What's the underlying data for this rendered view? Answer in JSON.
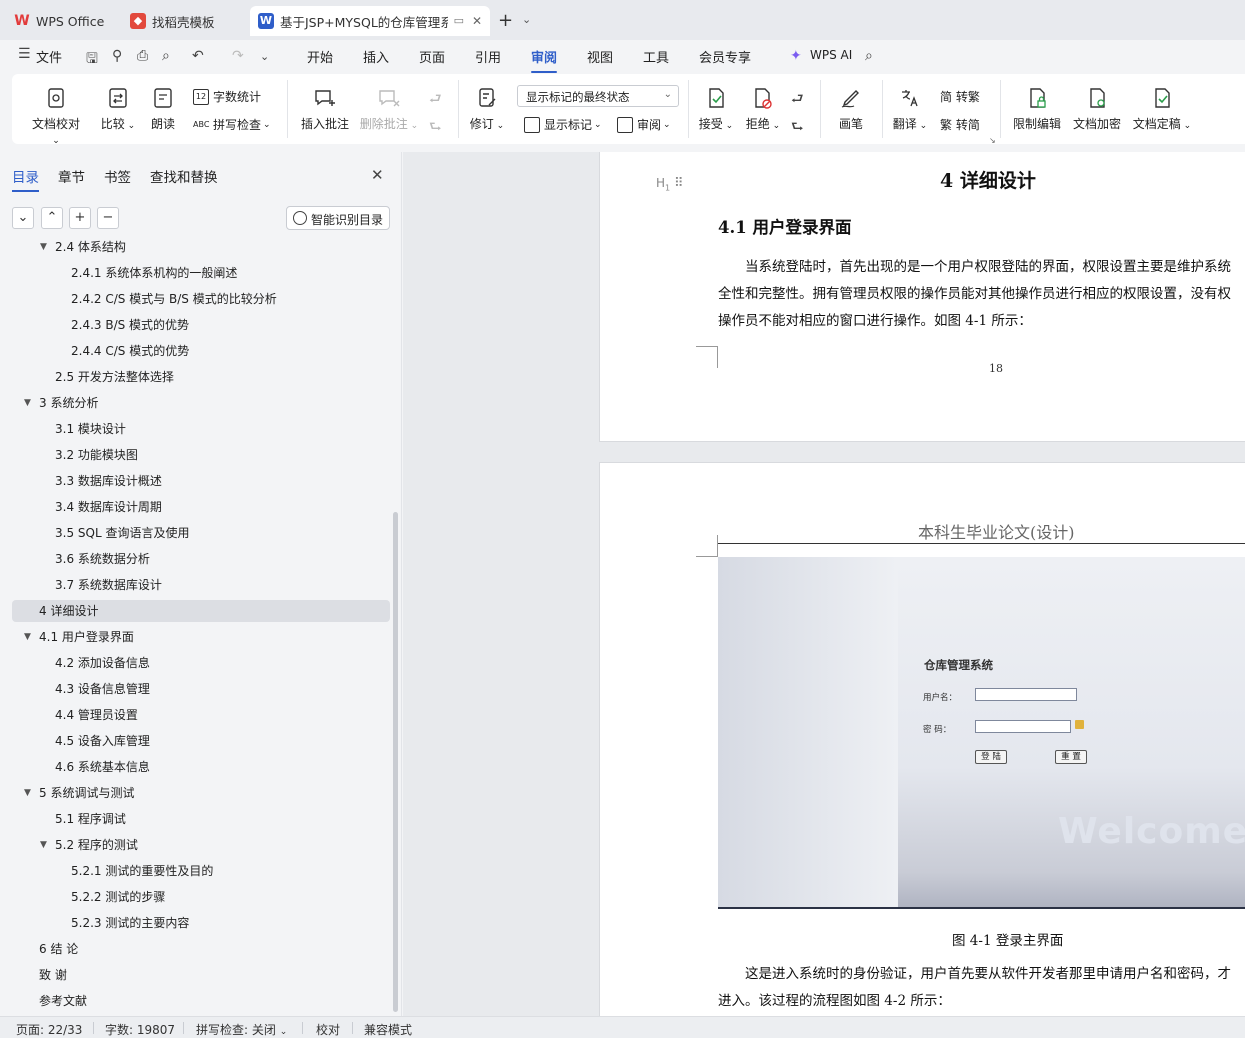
{
  "tabs": [
    {
      "label": "WPS Office",
      "icon": "wps-logo-icon"
    },
    {
      "label": "找稻壳模板",
      "icon": "docer-logo-icon"
    },
    {
      "label": "基于JSP+MYSQL的仓库管理系",
      "icon": "word-doc-icon"
    }
  ],
  "menu": {
    "file": "文件",
    "items": [
      "开始",
      "插入",
      "页面",
      "引用",
      "审阅",
      "视图",
      "工具",
      "会员专享"
    ],
    "active": "审阅",
    "wps_ai": "WPS AI"
  },
  "ribbon": {
    "doc_check": "文档校对",
    "compare": "比较",
    "read_aloud": "朗读",
    "word_count": "字数统计",
    "spell_check": "拼写检查",
    "insert_comment": "插入批注",
    "delete_comment": "删除批注",
    "revise": "修订",
    "display_state": "显示标记的最终状态",
    "show_markup": "显示标记",
    "review": "审阅",
    "accept": "接受",
    "reject": "拒绝",
    "pen": "画笔",
    "translate": "翻译",
    "to_traditional": "简 转繁",
    "to_simplified": "繁 转简",
    "restrict_edit": "限制编辑",
    "doc_encrypt": "文档加密",
    "doc_finalize": "文档定稿"
  },
  "sidebar": {
    "tabs": [
      "目录",
      "章节",
      "书签",
      "查找和替换"
    ],
    "smart_toc": "智能识别目录",
    "toc": [
      {
        "label": "2.4  体系结构",
        "level": 2,
        "expanded": true
      },
      {
        "label": "2.4.1  系统体系机构的一般阐述",
        "level": 3
      },
      {
        "label": "2.4.2 C/S 模式与 B/S 模式的比较分析",
        "level": 3
      },
      {
        "label": "2.4.3 B/S 模式的优势",
        "level": 3
      },
      {
        "label": "2.4.4 C/S 模式的优势",
        "level": 3
      },
      {
        "label": "2.5  开发方法整体选择",
        "level": 2
      },
      {
        "label": "3  系统分析",
        "level": 1,
        "expanded": true
      },
      {
        "label": "3.1  模块设计",
        "level": 2
      },
      {
        "label": "3.2  功能模块图",
        "level": 2
      },
      {
        "label": "3.3  数据库设计概述",
        "level": 2
      },
      {
        "label": "3.4  数据库设计周期",
        "level": 2
      },
      {
        "label": "3.5 SQL 查询语言及使用",
        "level": 2
      },
      {
        "label": "3.6  系统数据分析",
        "level": 2
      },
      {
        "label": "3.7  系统数据库设计",
        "level": 2
      },
      {
        "label": "4  详细设计",
        "level": 1,
        "selected": true
      },
      {
        "label": "4.1  用户登录界面",
        "level": 1,
        "expanded": true
      },
      {
        "label": "4.2  添加设备信息",
        "level": 2
      },
      {
        "label": "4.3  设备信息管理",
        "level": 2
      },
      {
        "label": "4.4  管理员设置",
        "level": 2
      },
      {
        "label": "4.5  设备入库管理",
        "level": 2
      },
      {
        "label": "4.6  系统基本信息",
        "level": 2
      },
      {
        "label": "5  系统调试与测试",
        "level": 1,
        "expanded": true
      },
      {
        "label": "5.1  程序调试",
        "level": 2
      },
      {
        "label": "5.2  程序的测试",
        "level": 2,
        "expanded": true
      },
      {
        "label": "5.2.1  测试的重要性及目的",
        "level": 3
      },
      {
        "label": "5.2.2  测试的步骤",
        "level": 3
      },
      {
        "label": "5.2.3  测试的主要内容",
        "level": 3
      },
      {
        "label": "6 结   论",
        "level": 1
      },
      {
        "label": "致   谢",
        "level": 1
      },
      {
        "label": "参考文献",
        "level": 1
      }
    ]
  },
  "document": {
    "heading": "4  详细设计",
    "heading_marker": "H",
    "subheading": "4.1 用户登录界面",
    "para1": [
      "当系统登陆时，首先出现的是一个用户权限登陆的界面，权限设置主要是维护系统",
      "全性和完整性。拥有管理员权限的操作员能对其他操作员进行相应的权限设置，没有权",
      "操作员不能对相应的窗口进行操作。如图 4-1 所示："
    ],
    "page_number": "18",
    "page2_header": "本科生毕业论文(设计)",
    "screenshot": {
      "title": "仓库管理系统",
      "user_label": "用户名：",
      "pass_label": "密  码：",
      "login_btn": "登 陆",
      "reset_btn": "重 置",
      "welcome": "Welcome"
    },
    "caption": "图 4-1  登录主界面",
    "para2": [
      "这是进入系统时的身份验证，用户首先要从软件开发者那里申请用户名和密码，才",
      "进入。该过程的流程图如图 4-2 所示："
    ]
  },
  "status": {
    "page": "页面: 22/33",
    "words": "字数: 19807",
    "spell": "拼写检查: 关闭",
    "proof": "校对",
    "compat": "兼容模式"
  },
  "colors": {
    "accent": "#2f5ec9",
    "wps_red": "#e23b3b",
    "word_blue": "#2f5ec9"
  }
}
